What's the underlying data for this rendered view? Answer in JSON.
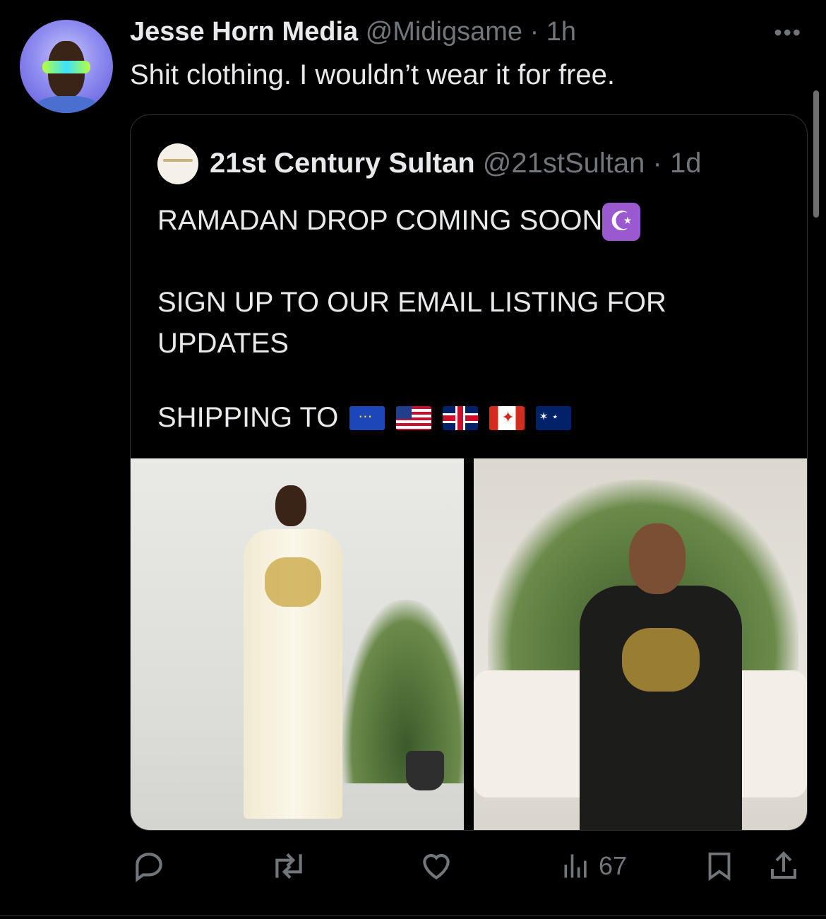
{
  "tweet": {
    "author_name": "Jesse Horn Media",
    "author_handle": "@Midigsame",
    "time": "1h",
    "text": "Shit clothing. I wouldn’t  wear it for free.",
    "more_icon": "ellipsis-icon"
  },
  "quoted": {
    "author_name": "21st Century Sultan",
    "author_handle": "@21stSultan",
    "time": "1d",
    "line1": "RAMADAN DROP COMING SOON",
    "moon_emoji": "☪",
    "line2": "SIGN UP TO OUR EMAIL LISTING FOR\nUPDATES",
    "shipping_label": "SHIPPING TO",
    "flags": [
      "eu-flag",
      "us-flag",
      "uk-flag",
      "canada-flag",
      "australia-flag"
    ]
  },
  "actions": {
    "reply_icon": "reply-icon",
    "retweet_icon": "retweet-icon",
    "like_icon": "heart-icon",
    "views_icon": "views-chart-icon",
    "views_count": "67",
    "bookmark_icon": "bookmark-icon",
    "share_icon": "share-icon"
  },
  "colors": {
    "background": "#000000",
    "text": "#e7e9ea",
    "muted": "#71767b",
    "border": "#2f3336"
  }
}
